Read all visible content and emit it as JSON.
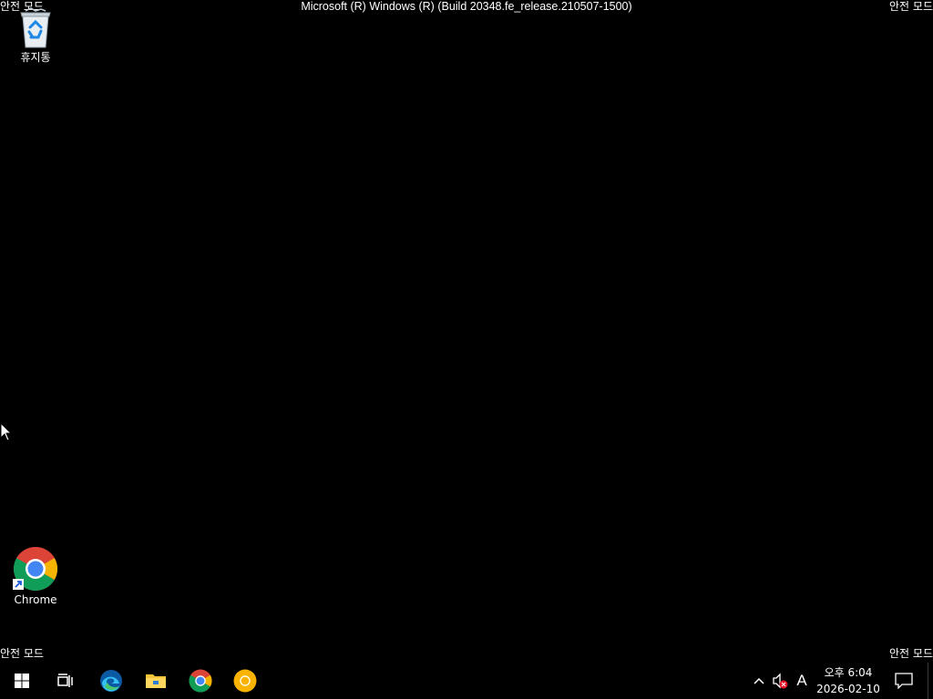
{
  "desktop": {
    "safe_mode_label": "안전 모드",
    "build_title": "Microsoft (R) Windows (R) (Build 20348.fe_release.210507-1500)",
    "icons": [
      {
        "label": "휴지통",
        "icon": "recycle-bin-icon"
      },
      {
        "label": "Chrome",
        "icon": "chrome-icon"
      }
    ]
  },
  "taskbar": {
    "pinned": [
      {
        "icon": "windows-start-icon"
      },
      {
        "icon": "task-view-icon"
      },
      {
        "icon": "edge-icon"
      },
      {
        "icon": "file-explorer-icon"
      },
      {
        "icon": "chrome-icon"
      },
      {
        "icon": "chrome-canary-icon"
      }
    ],
    "tray": {
      "ime_label": "A",
      "clock_period_time": "오후 6:04",
      "clock_date": "2026-02-10"
    }
  },
  "colors": {
    "background": "#000000",
    "text": "#ffffff",
    "windows_blue": "#ffffff",
    "chrome_red": "#db4437",
    "chrome_yellow": "#f4b400",
    "chrome_green": "#0f9d58",
    "chrome_blue": "#4285f4",
    "canary_yellow": "#f9b300",
    "folder_yellow": "#f8c53a",
    "mute_red": "#e81123"
  }
}
